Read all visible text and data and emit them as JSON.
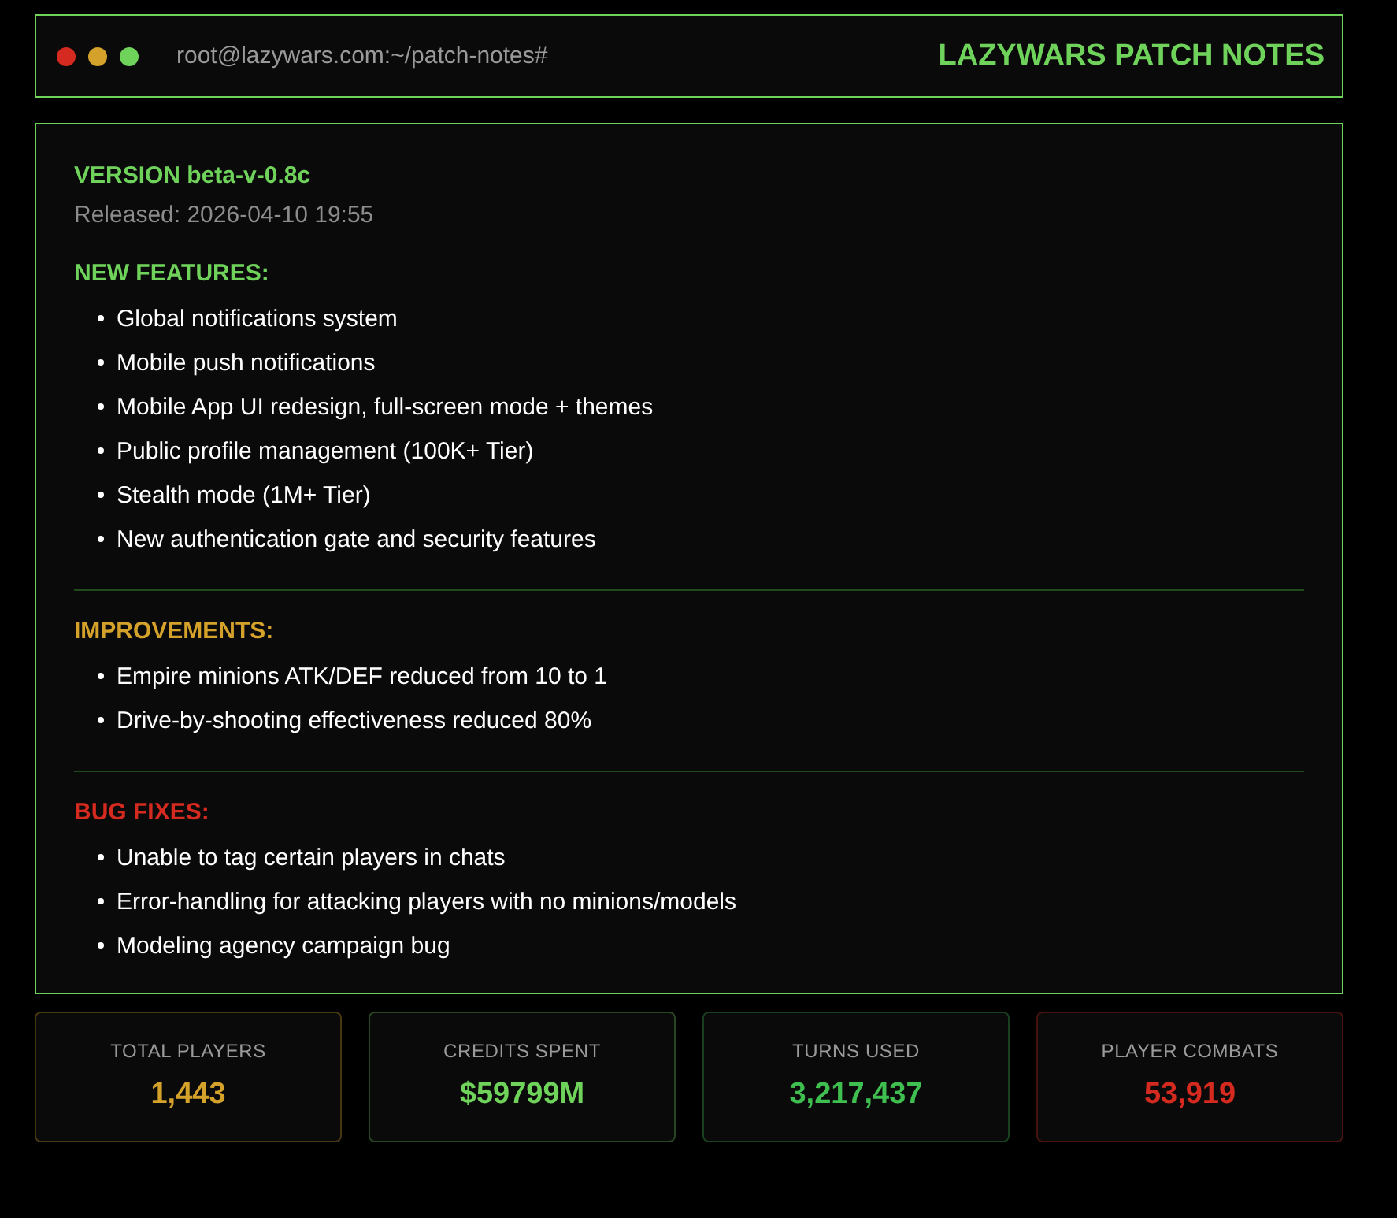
{
  "header": {
    "dots": [
      {
        "color": "#d42a1f"
      },
      {
        "color": "#d4a22b"
      },
      {
        "color": "#6fd35b"
      }
    ],
    "prompt": "root@lazywars.com:~/patch-notes#",
    "title": "LAZYWARS PATCH NOTES"
  },
  "release": {
    "version": "VERSION beta-v-0.8c",
    "released": "Released: 2026-04-10 19:55",
    "sections": [
      {
        "heading": "NEW FEATURES:",
        "color": "#6fd35b",
        "items": [
          "Global notifications system",
          "Mobile push notifications",
          "Mobile App UI redesign, full-screen mode + themes",
          "Public profile management (100K+ Tier)",
          "Stealth mode (1M+ Tier)",
          "New authentication gate and security features"
        ]
      },
      {
        "heading": "IMPROVEMENTS:",
        "color": "#d4a22b",
        "items": [
          "Empire minions ATK/DEF reduced from 10 to 1",
          "Drive-by-shooting effectiveness reduced 80%"
        ]
      },
      {
        "heading": "BUG FIXES:",
        "color": "#d42a1f",
        "items": [
          "Unable to tag certain players in chats",
          "Error-handling for attacking players with no minions/models",
          "Modeling agency campaign bug"
        ]
      }
    ]
  },
  "stats": [
    {
      "label": "TOTAL PLAYERS",
      "value": "1,443",
      "color": "#d4a22b"
    },
    {
      "label": "CREDITS SPENT",
      "value": "$59799M",
      "color": "#6fd35b"
    },
    {
      "label": "TURNS USED",
      "value": "3,217,437",
      "color": "#3fbf4f"
    },
    {
      "label": "PLAYER COMBATS",
      "value": "53,919",
      "color": "#d42a1f"
    }
  ]
}
